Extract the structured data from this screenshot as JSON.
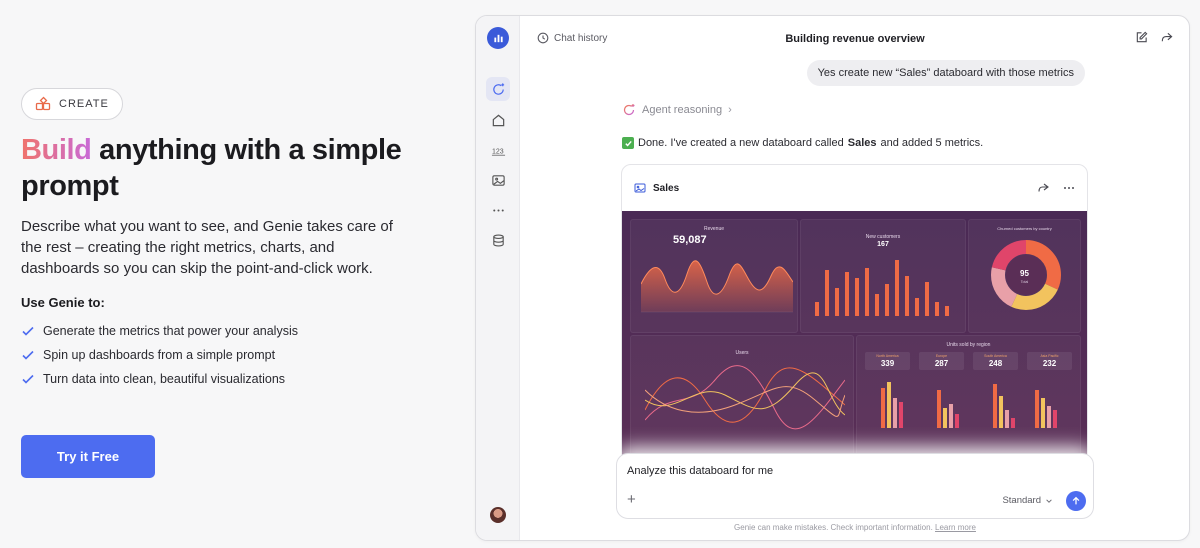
{
  "hero": {
    "badge_label": "CREATE",
    "headline_accent": "Build",
    "headline_rest": " anything with a simple prompt",
    "description": "Describe what you want to see, and Genie takes care of the rest – creating the right metrics, charts, and dashboards so you can skip the point-and-click work.",
    "use_title": "Use Genie to:",
    "features": [
      "Generate the metrics that power your analysis",
      "Spin up dashboards from a simple prompt",
      "Turn data into clean, beautiful visualizations"
    ],
    "cta_label": "Try it Free"
  },
  "app": {
    "chat_history_label": "Chat history",
    "conversation_title": "Building revenue overview",
    "user_message": "Yes create new “Sales” databoard with those metrics",
    "reasoning_label": "Agent reasoning",
    "done_prefix": "Done. I've created a new databoard called ",
    "done_bold": "Sales",
    "done_suffix": " and added 5 metrics.",
    "card_title": "Sales",
    "dashboard": {
      "revenue_title": "Revenue",
      "revenue_value": "59,087",
      "new_customers_title": "New customers",
      "new_customers_value": "167",
      "donut_title": "Churned customers by country",
      "donut_value": "95",
      "donut_sub": "Total",
      "users_title": "Users",
      "units_title": "Units sold by region",
      "regions": [
        {
          "label": "North America",
          "value": "339"
        },
        {
          "label": "Europe",
          "value": "287"
        },
        {
          "label": "South America",
          "value": "248"
        },
        {
          "label": "Asia Pacific",
          "value": "232"
        }
      ]
    },
    "composer_text": "Analyze this databoard for me",
    "model_label": "Standard",
    "disclaimer_text": "Genie can make mistakes. Check important information.",
    "learn_more": "Learn more"
  },
  "colors": {
    "accent": "#4d6cf0",
    "dashboard_bg": "#4a2a55",
    "chart_orange": "#f06b45",
    "chart_pink": "#e86a8a",
    "chart_yellow": "#f2c35e"
  }
}
